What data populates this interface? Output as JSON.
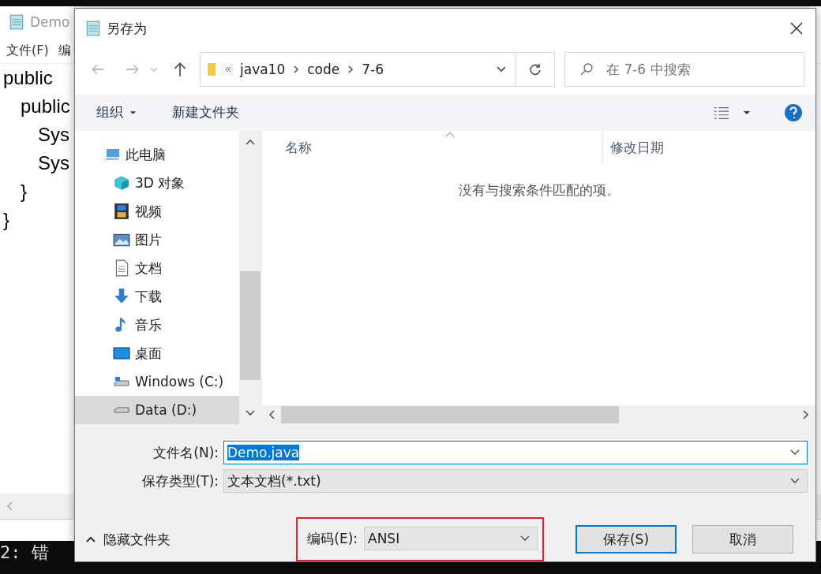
{
  "background": {
    "notepad_title": "Demo",
    "menu": [
      "文件(F)",
      "编"
    ],
    "code_lines": [
      {
        "text": "public",
        "children": [
          {
            "text": "public",
            "children": [
              {
                "text": "Sys"
              },
              {
                "text": "Sys"
              }
            ]
          },
          {
            "text": "}"
          }
        ]
      },
      {
        "text": "}"
      }
    ],
    "terminal_text": "2: 错"
  },
  "dialog": {
    "title": "另存为",
    "address": {
      "crumbs": [
        "java10",
        "code",
        "7-6"
      ]
    },
    "search": {
      "placeholder": "在 7-6 中搜索"
    },
    "toolbar": {
      "organize": "组织",
      "new_folder": "新建文件夹"
    },
    "nav_items": [
      {
        "label": "此电脑",
        "selected": false,
        "children": [
          {
            "label": "3D 对象",
            "selected": false
          },
          {
            "label": "视频",
            "selected": false
          },
          {
            "label": "图片",
            "selected": false
          },
          {
            "label": "文档",
            "selected": false
          },
          {
            "label": "下载",
            "selected": false
          },
          {
            "label": "音乐",
            "selected": false
          },
          {
            "label": "桌面",
            "selected": false
          },
          {
            "label": "Windows (C:)",
            "selected": false
          },
          {
            "label": "Data (D:)",
            "selected": true
          }
        ]
      }
    ],
    "columns": [
      "名称",
      "修改日期"
    ],
    "empty_message": "没有与搜索条件匹配的项。",
    "filename": {
      "label": "文件名(N):",
      "value": "Demo.java"
    },
    "filetype": {
      "label": "保存类型(T):",
      "value": "文本文档(*.txt)"
    },
    "hide_folders": "隐藏文件夹",
    "encoding": {
      "label": "编码(E):",
      "value": "ANSI",
      "highlighted": true
    },
    "buttons": [
      {
        "label": "保存(S)",
        "kind": "primary"
      },
      {
        "label": "取消",
        "kind": "normal"
      }
    ]
  }
}
